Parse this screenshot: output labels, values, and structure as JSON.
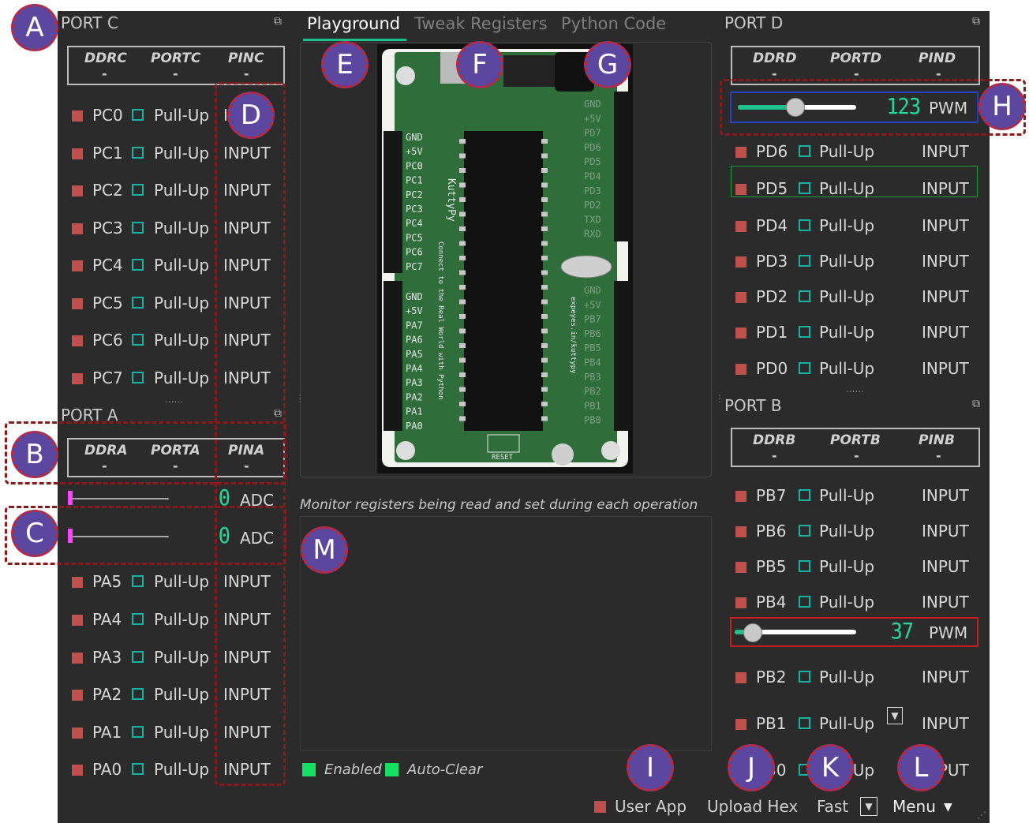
{
  "tabs": [
    "Playground",
    "Tweak Registers",
    "Python Code"
  ],
  "port_c": {
    "title": "PORT C",
    "headers": [
      "DDRC",
      "PORTC",
      "PINC"
    ],
    "values": [
      "-",
      "-",
      "-"
    ],
    "pins": [
      {
        "name": "PC0",
        "pull": "Pull-Up",
        "mode": "INPUT"
      },
      {
        "name": "PC1",
        "pull": "Pull-Up",
        "mode": "INPUT"
      },
      {
        "name": "PC2",
        "pull": "Pull-Up",
        "mode": "INPUT"
      },
      {
        "name": "PC3",
        "pull": "Pull-Up",
        "mode": "INPUT"
      },
      {
        "name": "PC4",
        "pull": "Pull-Up",
        "mode": "INPUT"
      },
      {
        "name": "PC5",
        "pull": "Pull-Up",
        "mode": "INPUT"
      },
      {
        "name": "PC6",
        "pull": "Pull-Up",
        "mode": "INPUT"
      },
      {
        "name": "PC7",
        "pull": "Pull-Up",
        "mode": "INPUT"
      }
    ]
  },
  "port_a": {
    "title": "PORT A",
    "headers": [
      "DDRA",
      "PORTA",
      "PINA"
    ],
    "values": [
      "-",
      "-",
      "-"
    ],
    "adc": [
      {
        "value": "0",
        "label": "ADC"
      },
      {
        "value": "0",
        "label": "ADC"
      }
    ],
    "pins": [
      {
        "name": "PA5",
        "pull": "Pull-Up",
        "mode": "INPUT"
      },
      {
        "name": "PA4",
        "pull": "Pull-Up",
        "mode": "INPUT"
      },
      {
        "name": "PA3",
        "pull": "Pull-Up",
        "mode": "INPUT"
      },
      {
        "name": "PA2",
        "pull": "Pull-Up",
        "mode": "INPUT"
      },
      {
        "name": "PA1",
        "pull": "Pull-Up",
        "mode": "INPUT"
      },
      {
        "name": "PA0",
        "pull": "Pull-Up",
        "mode": "INPUT"
      }
    ]
  },
  "port_d": {
    "title": "PORT D",
    "headers": [
      "DDRD",
      "PORTD",
      "PIND"
    ],
    "values": [
      "-",
      "-",
      "-"
    ],
    "pwm": {
      "value": "123",
      "label": "PWM",
      "level": 0.48
    },
    "pins": [
      {
        "name": "PD6",
        "pull": "Pull-Up",
        "mode": "INPUT"
      },
      {
        "name": "PD5",
        "pull": "Pull-Up",
        "mode": "INPUT"
      },
      {
        "name": "PD4",
        "pull": "Pull-Up",
        "mode": "INPUT"
      },
      {
        "name": "PD3",
        "pull": "Pull-Up",
        "mode": "INPUT"
      },
      {
        "name": "PD2",
        "pull": "Pull-Up",
        "mode": "INPUT"
      },
      {
        "name": "PD1",
        "pull": "Pull-Up",
        "mode": "INPUT"
      },
      {
        "name": "PD0",
        "pull": "Pull-Up",
        "mode": "INPUT"
      }
    ]
  },
  "port_b": {
    "title": "PORT B",
    "headers": [
      "DDRB",
      "PORTB",
      "PINB"
    ],
    "values": [
      "-",
      "-",
      "-"
    ],
    "pwm": {
      "value": "37",
      "label": "PWM",
      "level": 0.14
    },
    "pins": [
      {
        "name": "PB7",
        "pull": "Pull-Up",
        "mode": "INPUT"
      },
      {
        "name": "PB6",
        "pull": "Pull-Up",
        "mode": "INPUT"
      },
      {
        "name": "PB5",
        "pull": "Pull-Up",
        "mode": "INPUT"
      },
      {
        "name": "PB4",
        "pull": "Pull-Up",
        "mode": "INPUT"
      },
      {
        "name": "PB2",
        "pull": "Pull-Up",
        "mode": "INPUT"
      },
      {
        "name": "PB1",
        "pull": "Pull-Up",
        "mode": "INPUT"
      },
      {
        "name": "PB0",
        "pull": "Pull-Up",
        "mode": "INPUT"
      }
    ]
  },
  "board": {
    "left_pins": [
      "GND",
      "+5V",
      "PC0",
      "PC1",
      "PC2",
      "PC3",
      "PC4",
      "PC5",
      "PC6",
      "PC7",
      "GND",
      "+5V",
      "PA7",
      "PA6",
      "PA5",
      "PA4",
      "PA3",
      "PA2",
      "PA1",
      "PA0"
    ],
    "right_pins_top": [
      "GND",
      "+5V",
      "PD7",
      "PD6",
      "PD5",
      "PD4",
      "PD3",
      "PD2",
      "TXD",
      "RXD"
    ],
    "right_pins_bottom": [
      "GND",
      "+5V",
      "PB7",
      "PB6",
      "PB5",
      "PB4",
      "PB3",
      "PB2",
      "PB1",
      "PB0"
    ],
    "brand": "KuttyPy",
    "tagline": "Connect to the Real World with Python",
    "url": "expeyes.in/kuttypy",
    "reset": "RESET"
  },
  "monitor": {
    "caption": "Monitor registers being read and set during each operation",
    "enabled_label": "Enabled",
    "autoclear_label": "Auto-Clear"
  },
  "bottom": {
    "user_app": "User App",
    "upload_hex": "Upload Hex",
    "speed": "Fast",
    "menu": "Menu"
  },
  "markers": [
    "A",
    "B",
    "C",
    "D",
    "E",
    "F",
    "G",
    "H",
    "I",
    "J",
    "K",
    "L",
    "M"
  ],
  "colors": {
    "background": "#2b2b2b",
    "led_off": "#c0504d",
    "checkbox": "#12b5a5",
    "lcd": "#1ddc9a",
    "slider": "#1dbf8a",
    "marker_fill": "#5b46a0",
    "marker_border": "#d0202a"
  }
}
